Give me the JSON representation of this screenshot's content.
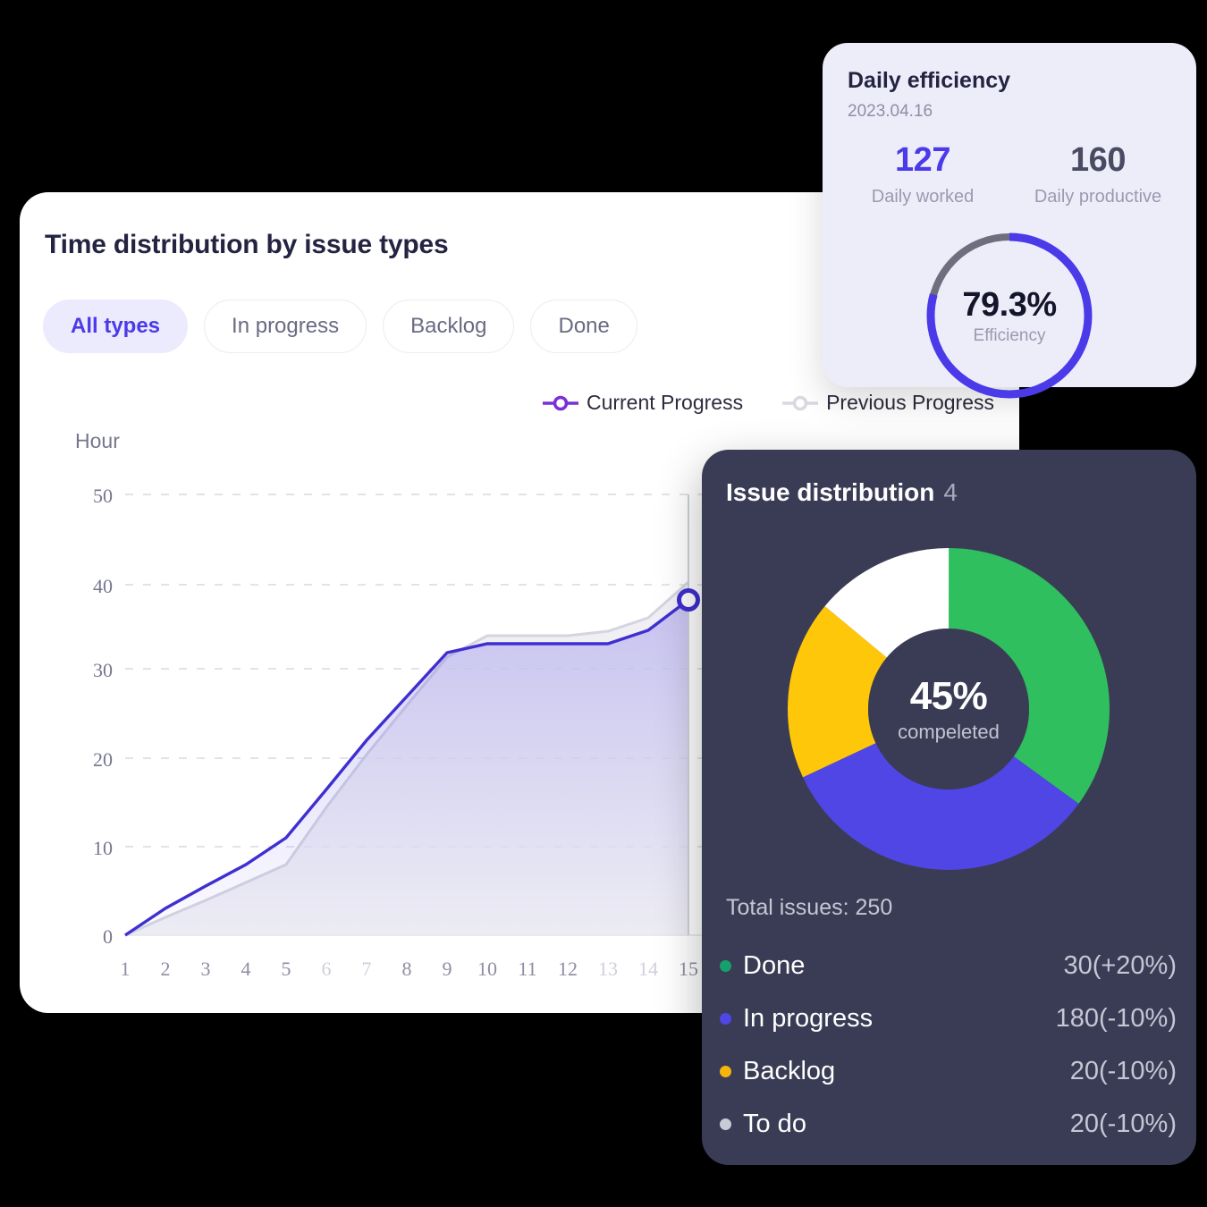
{
  "time_card": {
    "title": "Time distribution by issue types",
    "tabs": [
      {
        "label": "All types",
        "active": true
      },
      {
        "label": "In progress",
        "active": false
      },
      {
        "label": "Backlog",
        "active": false
      },
      {
        "label": "Done",
        "active": false
      }
    ],
    "legend": [
      {
        "label": "Current Progress",
        "color": "#7B2FD6"
      },
      {
        "label": "Previous Progress",
        "color": "#D9D9E3"
      }
    ]
  },
  "efficiency_card": {
    "title": "Daily efficiency",
    "date": "2023.04.16",
    "stats": [
      {
        "value": "127",
        "caption": "Daily worked",
        "color": "#4B3AE8"
      },
      {
        "value": "160",
        "caption": "Daily productive",
        "color": "#4A4A63"
      }
    ],
    "ring": {
      "value": "79.3%",
      "caption": "Efficiency",
      "percent": 79.3,
      "arc_color": "#4B3AE8",
      "track_color": "#6E6E7E"
    }
  },
  "issue_card": {
    "title": "Issue distribution",
    "count": "4",
    "donut_center_value": "45%",
    "donut_center_caption": "compeleted",
    "total_label": "Total issues: 250",
    "legend": [
      {
        "label": "Done",
        "value": "30(+20%)",
        "color": "#16A06B"
      },
      {
        "label": "In progress",
        "value": "180(-10%)",
        "color": "#4F46E5"
      },
      {
        "label": "Backlog",
        "value": "20(-10%)",
        "color": "#F5B50A"
      },
      {
        "label": "To do",
        "value": "20(-10%)",
        "color": "#C8CAD6"
      }
    ]
  },
  "chart_data": [
    {
      "type": "area",
      "title": "Time distribution by issue types",
      "xlabel": "",
      "ylabel": "Hour",
      "x": [
        1,
        2,
        3,
        4,
        5,
        6,
        7,
        8,
        9,
        10,
        11,
        12,
        13,
        14,
        15
      ],
      "xticks": [
        "1",
        "2",
        "3",
        "4",
        "5",
        "6",
        "7",
        "8",
        "9",
        "10",
        "11",
        "12",
        "13",
        "14",
        "15"
      ],
      "dim_xticks": [
        "6",
        "7",
        "13",
        "14"
      ],
      "yticks": [
        0,
        10,
        20,
        30,
        40,
        50
      ],
      "ylim": [
        0,
        50
      ],
      "grid": "horizontal-dashed",
      "legend_position": "top-right",
      "hover_x": 15,
      "hover_value": 38,
      "series": [
        {
          "name": "Current Progress",
          "color": "#3F2FD0",
          "values": [
            0,
            3,
            5.5,
            8,
            11,
            16.5,
            22,
            27,
            32,
            33,
            33,
            33,
            33,
            34.5,
            38
          ]
        },
        {
          "name": "Previous Progress",
          "color": "#D9D9E3",
          "values": [
            0,
            2,
            4,
            6,
            8,
            14.5,
            20.5,
            26,
            31.5,
            34,
            34,
            34,
            34.5,
            36,
            40
          ]
        }
      ]
    },
    {
      "type": "pie",
      "title": "Issue distribution",
      "subtitle": "45% compeleted",
      "total": 250,
      "labels": [
        "Done",
        "In progress",
        "Backlog",
        "To do"
      ],
      "values": [
        30,
        180,
        20,
        20
      ],
      "slice_fractions": [
        0.35,
        0.33,
        0.18,
        0.14
      ],
      "colors": [
        "#2FBF5F",
        "#4F46E5",
        "#FFC709",
        "#FFFFFF"
      ],
      "deltas": [
        "+20%",
        "-10%",
        "-10%",
        "-10%"
      ],
      "legend_position": "bottom"
    },
    {
      "type": "pie",
      "title": "Daily efficiency",
      "subtitle": "79.3% Efficiency",
      "labels": [
        "Efficiency",
        "Remaining"
      ],
      "values": [
        79.3,
        20.7
      ],
      "colors": [
        "#4B3AE8",
        "#6E6E7E"
      ],
      "legend_position": "none"
    }
  ]
}
